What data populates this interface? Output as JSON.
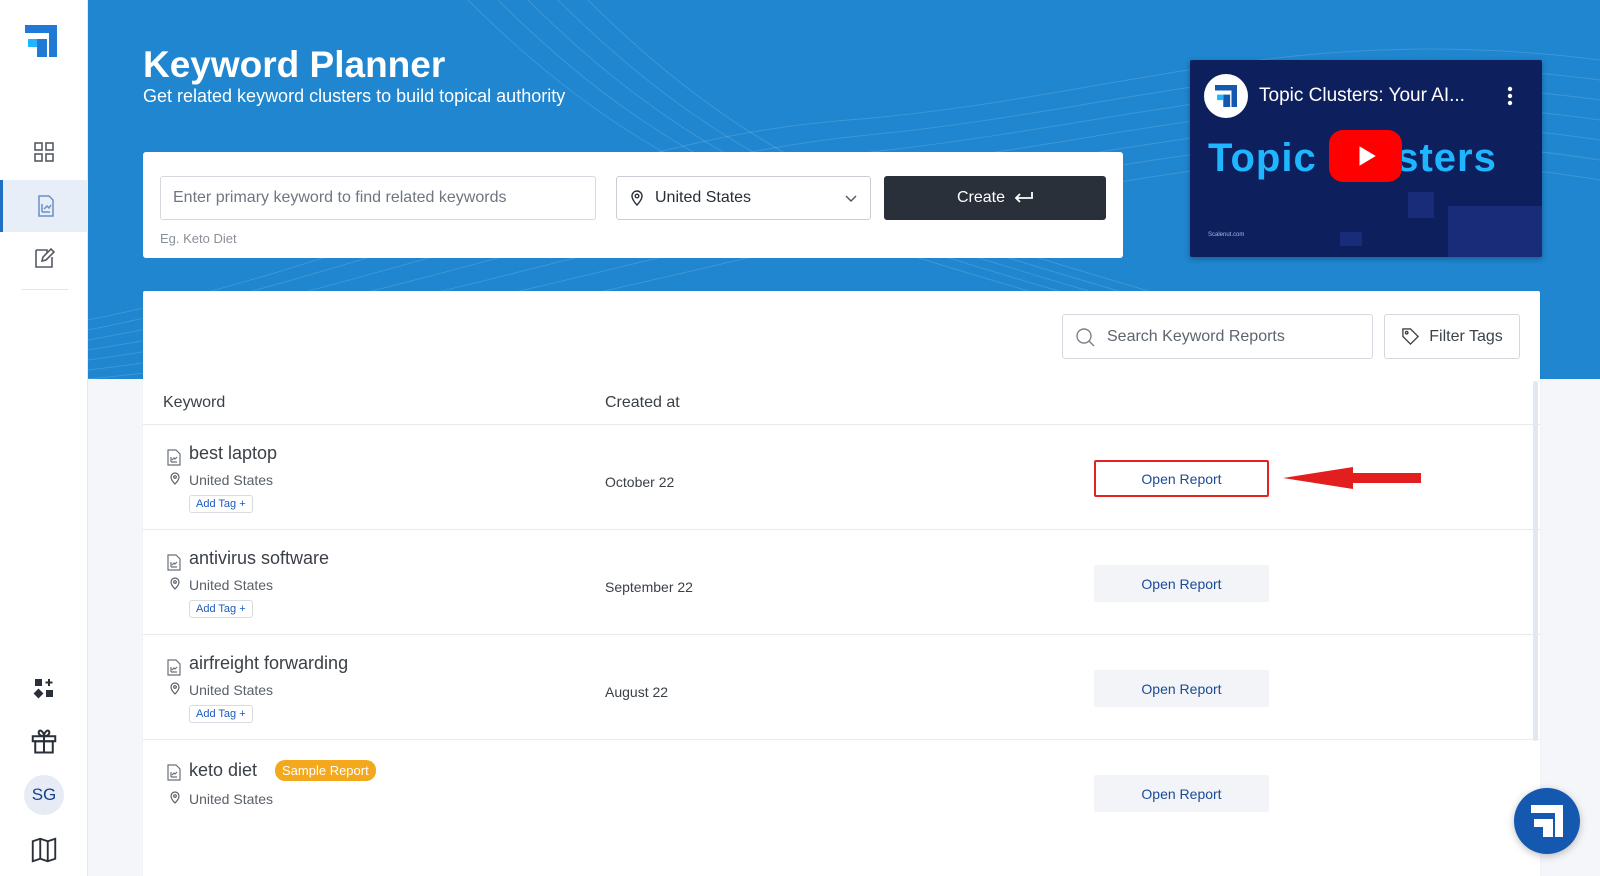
{
  "app": {
    "title": "Keyword Planner",
    "subtitle": "Get related keyword clusters to build topical authority",
    "brand_color": "#1f86cf",
    "dark_button_color": "#2a3039"
  },
  "sidebar": {
    "items": [
      {
        "icon": "dashboard-grid-icon"
      },
      {
        "icon": "chart-report-icon",
        "active": true
      },
      {
        "icon": "edit-document-icon"
      },
      {
        "icon": "apps-add-icon"
      },
      {
        "icon": "gift-icon"
      },
      {
        "icon": "book-icon"
      }
    ],
    "avatar_initials": "SG"
  },
  "create_form": {
    "keyword_placeholder": "Enter primary keyword to find related keywords",
    "keyword_value": "",
    "country": "United States",
    "create_label": "Create",
    "example_hint": "Eg. Keto Diet"
  },
  "video": {
    "title": "Topic Clusters: Your AI...",
    "thumbnail_text": "Topic Clusters",
    "footer_text": "Scalenut.com"
  },
  "reports": {
    "search_placeholder": "Search Keyword Reports",
    "filter_label": "Filter Tags",
    "columns": {
      "keyword": "Keyword",
      "created_at": "Created at"
    },
    "open_label": "Open Report",
    "add_tag_label": "Add Tag +",
    "sample_badge": "Sample Report",
    "rows": [
      {
        "keyword": "best laptop",
        "location": "United States",
        "created_at": "October 22",
        "highlighted": true
      },
      {
        "keyword": "antivirus software",
        "location": "United States",
        "created_at": "September 22"
      },
      {
        "keyword": "airfreight forwarding",
        "location": "United States",
        "created_at": "August 22"
      },
      {
        "keyword": "keto diet",
        "location": "United States",
        "created_at": "",
        "sample": true
      }
    ]
  }
}
